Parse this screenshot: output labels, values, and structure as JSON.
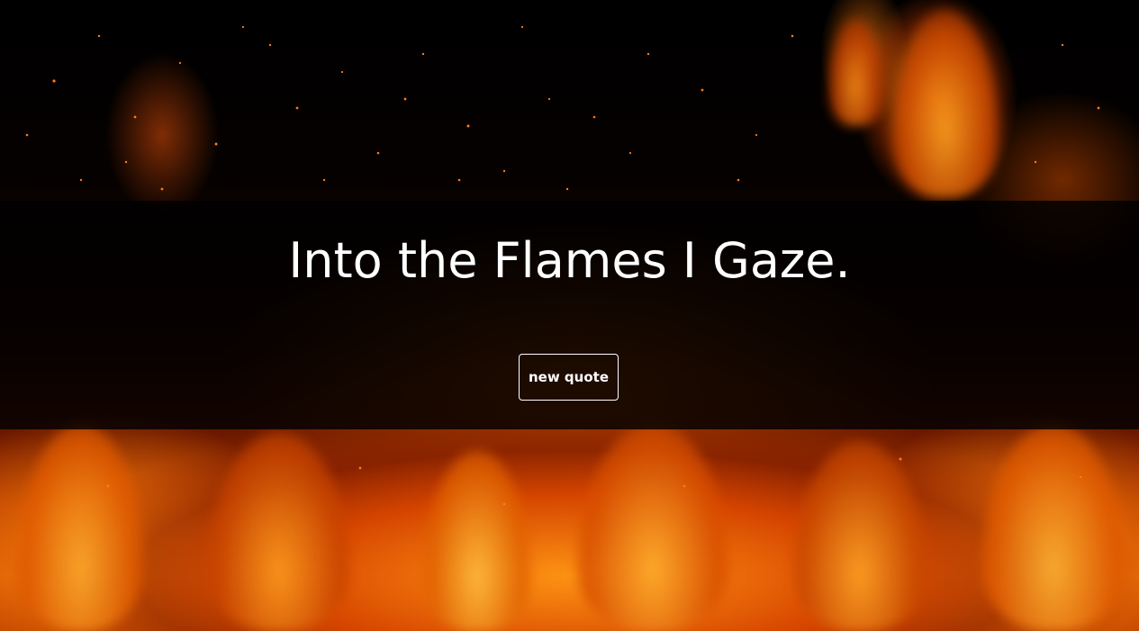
{
  "quote": {
    "text": "Into the Flames I Gaze."
  },
  "actions": {
    "new_quote_label": "new quote"
  },
  "theme": {
    "background_image": "fire-flames-image",
    "text_color": "#ffffff",
    "band_color": "#000000",
    "fire_colors": [
      "#ff8c14",
      "#d85a05",
      "#b33a00",
      "#2a0800"
    ]
  }
}
